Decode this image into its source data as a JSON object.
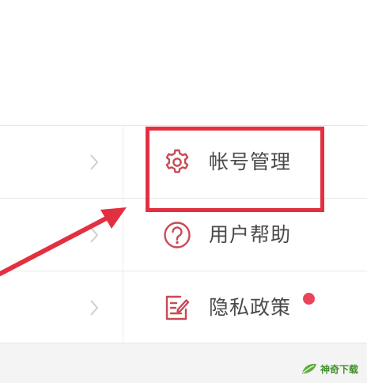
{
  "menu": {
    "items": [
      {
        "label": "帐号管理",
        "icon": "gear-icon",
        "dot": false
      },
      {
        "label": "用户帮助",
        "icon": "question-circle-icon",
        "dot": false
      },
      {
        "label": "隐私政策",
        "icon": "document-edit-icon",
        "dot": true
      }
    ]
  },
  "colors": {
    "icon": "#c84a55",
    "highlight": "#e33040",
    "dot": "#e8455b"
  },
  "watermark": {
    "text": "神奇下载"
  }
}
